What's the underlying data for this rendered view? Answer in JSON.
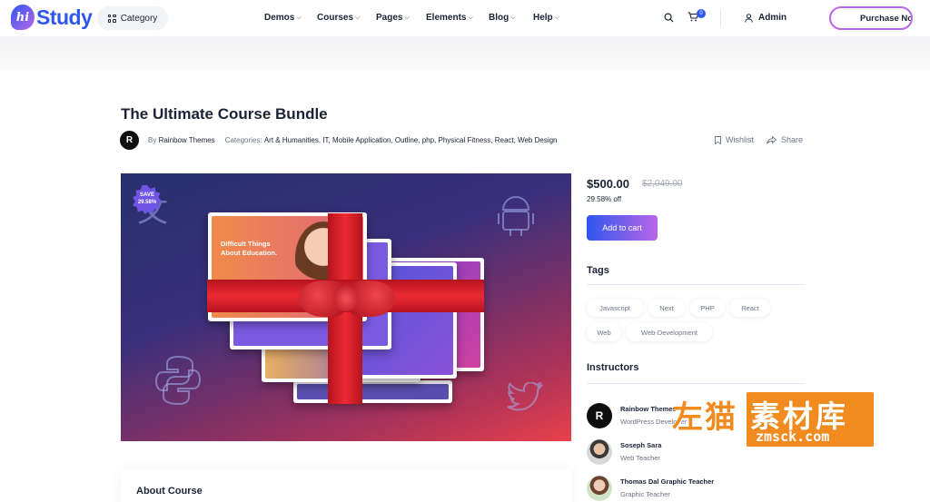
{
  "header": {
    "logo_mark": "hi",
    "logo_text": "Study",
    "category_label": "Category",
    "nav": [
      "Demos",
      "Courses",
      "Pages",
      "Elements",
      "Blog",
      "Help"
    ],
    "cart_count": "0",
    "admin_label": "Admin",
    "purchase_label": "Purchase No"
  },
  "course": {
    "title": "The Ultimate Course Bundle",
    "author_prefix": "By",
    "author": "Rainbow Themes",
    "categories_prefix": "Categories:",
    "categories": "Art & Humanities, IT, Mobile Application, Outline, php, Physical Fitness, React, Web Design",
    "wishlist_label": "Wishlist",
    "share_label": "Share"
  },
  "hero": {
    "save_label": "SAVE",
    "save_percent": "29.58%",
    "card_title": "Difficult Things About Education."
  },
  "pricing": {
    "price": "$500.00",
    "old_price": "$2,049.00",
    "off_label": "29.58% off",
    "cart_label": "Add to cart"
  },
  "tags": {
    "title": "Tags",
    "items": [
      "Javascript",
      "Next",
      "PHP",
      "React",
      "Web",
      "Web-Development"
    ]
  },
  "instructors": {
    "title": "Instructors",
    "items": [
      {
        "name": "Rainbow Themes",
        "role": "WordPress Developer"
      },
      {
        "name": "Soseph Sara",
        "role": "Web Teacher"
      },
      {
        "name": "Thomas Dal Graphic Teacher",
        "role": "Graphic Teacher"
      }
    ]
  },
  "about": {
    "title": "About Course"
  },
  "watermark": {
    "cn_left": "左猫",
    "cn_right": "素材库",
    "url": "zmsck.com"
  },
  "colors": {
    "primary": "#2f57ef",
    "secondary": "#b966e7",
    "heading": "#192335",
    "body": "#6b7385"
  }
}
